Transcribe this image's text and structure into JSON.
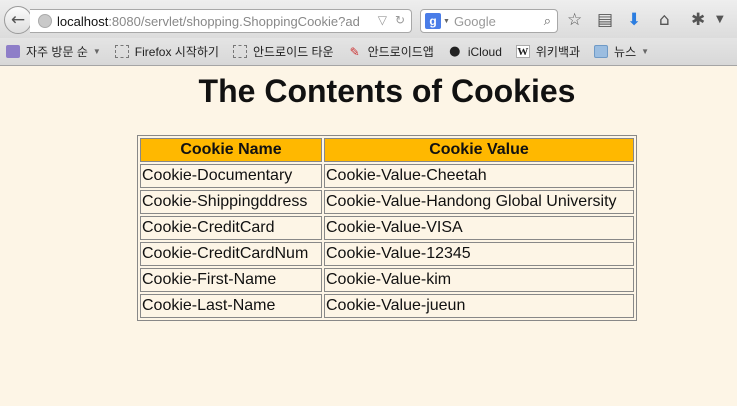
{
  "browser": {
    "url_host": "localhost",
    "url_path": ":8080/servlet/shopping.ShoppingCookie?ad",
    "search_placeholder": "Google",
    "bookmarks": [
      {
        "label": "자주 방문 순",
        "icon": "folder-purple",
        "dropdown": true
      },
      {
        "label": "Firefox 시작하기",
        "icon": "dashed",
        "dropdown": false
      },
      {
        "label": "안드로이드 타운",
        "icon": "dashed",
        "dropdown": false
      },
      {
        "label": "안드로이드앱",
        "icon": "brush",
        "dropdown": false
      },
      {
        "label": "iCloud",
        "icon": "apple",
        "dropdown": false
      },
      {
        "label": "위키백과",
        "icon": "wiki",
        "dropdown": false
      },
      {
        "label": "뉴스",
        "icon": "folder-blue",
        "dropdown": true
      }
    ]
  },
  "page": {
    "title": "The Contents of Cookies",
    "table": {
      "headers": [
        "Cookie Name",
        "Cookie Value"
      ],
      "rows": [
        [
          "Cookie-Documentary",
          "Cookie-Value-Cheetah"
        ],
        [
          "Cookie-Shippingddress",
          "Cookie-Value-Handong Global University"
        ],
        [
          "Cookie-CreditCard",
          "Cookie-Value-VISA"
        ],
        [
          "Cookie-CreditCardNum",
          "Cookie-Value-12345"
        ],
        [
          "Cookie-First-Name",
          "Cookie-Value-kim"
        ],
        [
          "Cookie-Last-Name",
          "Cookie-Value-jueun"
        ]
      ]
    }
  },
  "colors": {
    "page_background": "#fdf5e6",
    "header_background": "#ffb800"
  }
}
